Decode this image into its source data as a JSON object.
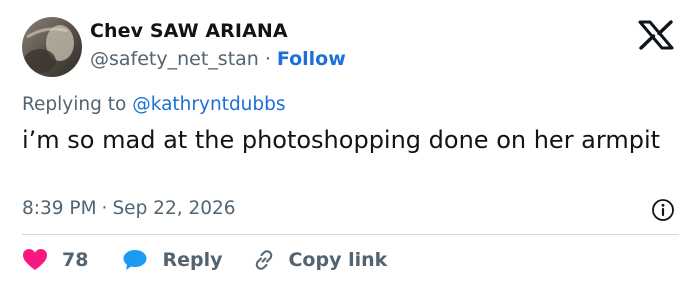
{
  "tweet": {
    "author_name": "Chev SAW ARIANA",
    "author_handle": "@safety_net_stan",
    "separator": "·",
    "follow_label": "Follow",
    "replying_prefix": "Replying to",
    "replying_to": "@kathryntdubbs",
    "text": "i’m so mad at the photoshopping done on her armpit",
    "time": "8:39 PM",
    "date": "Sep 22, 2026"
  },
  "actions": {
    "like_count": "78",
    "reply_label": "Reply",
    "copy_link_label": "Copy link"
  },
  "colors": {
    "link": "#1d6fd9",
    "like": "#f91880",
    "reply": "#1d9bf0",
    "muted": "#536471",
    "text": "#0f1419"
  },
  "icons": [
    "x-logo-icon",
    "info-icon",
    "heart-icon",
    "reply-bubble-icon",
    "link-icon"
  ]
}
